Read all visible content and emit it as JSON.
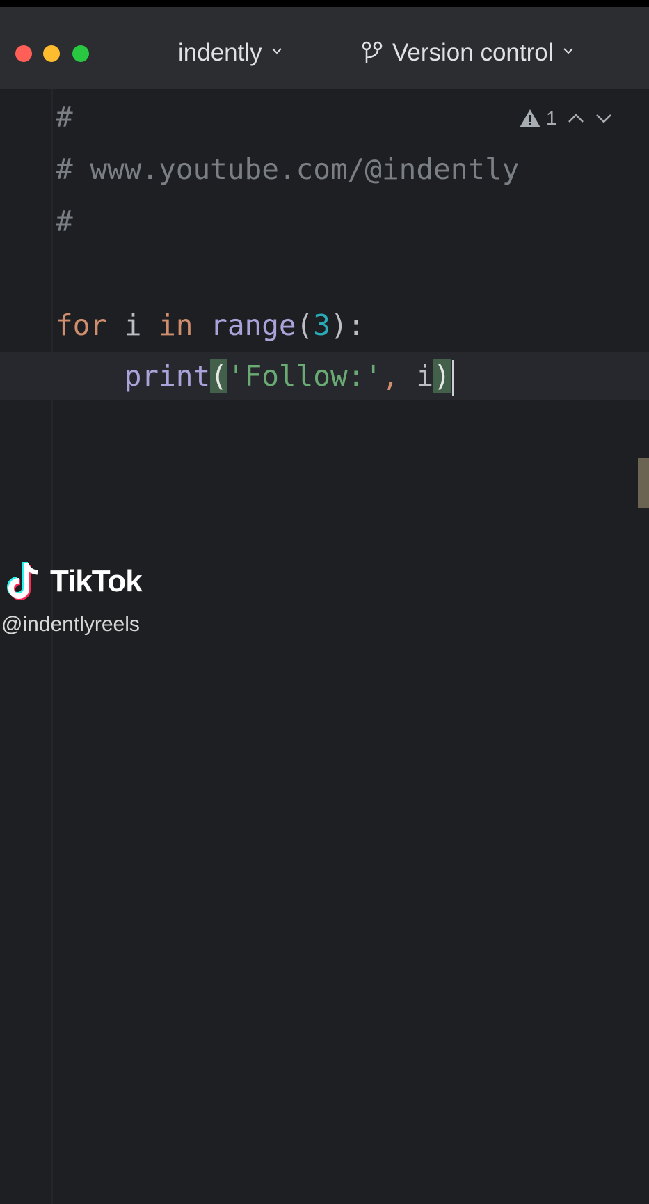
{
  "titlebar": {
    "project_name": "indently",
    "vcs_label": "Version control"
  },
  "editor": {
    "lines": [
      "#",
      "# www.youtube.com/@indently",
      "#",
      "",
      "for i in range(3):",
      "    print('Follow:', i)"
    ],
    "tokens": {
      "for": "for",
      "i": "i",
      "in": "in",
      "range": "range",
      "three": "3",
      "print": "print",
      "string": "'Follow:'",
      "comma": ", ",
      "arg": "i"
    },
    "warning_count": "1"
  },
  "watermark": {
    "brand": "TikTok",
    "handle": "@indentlyreels"
  }
}
